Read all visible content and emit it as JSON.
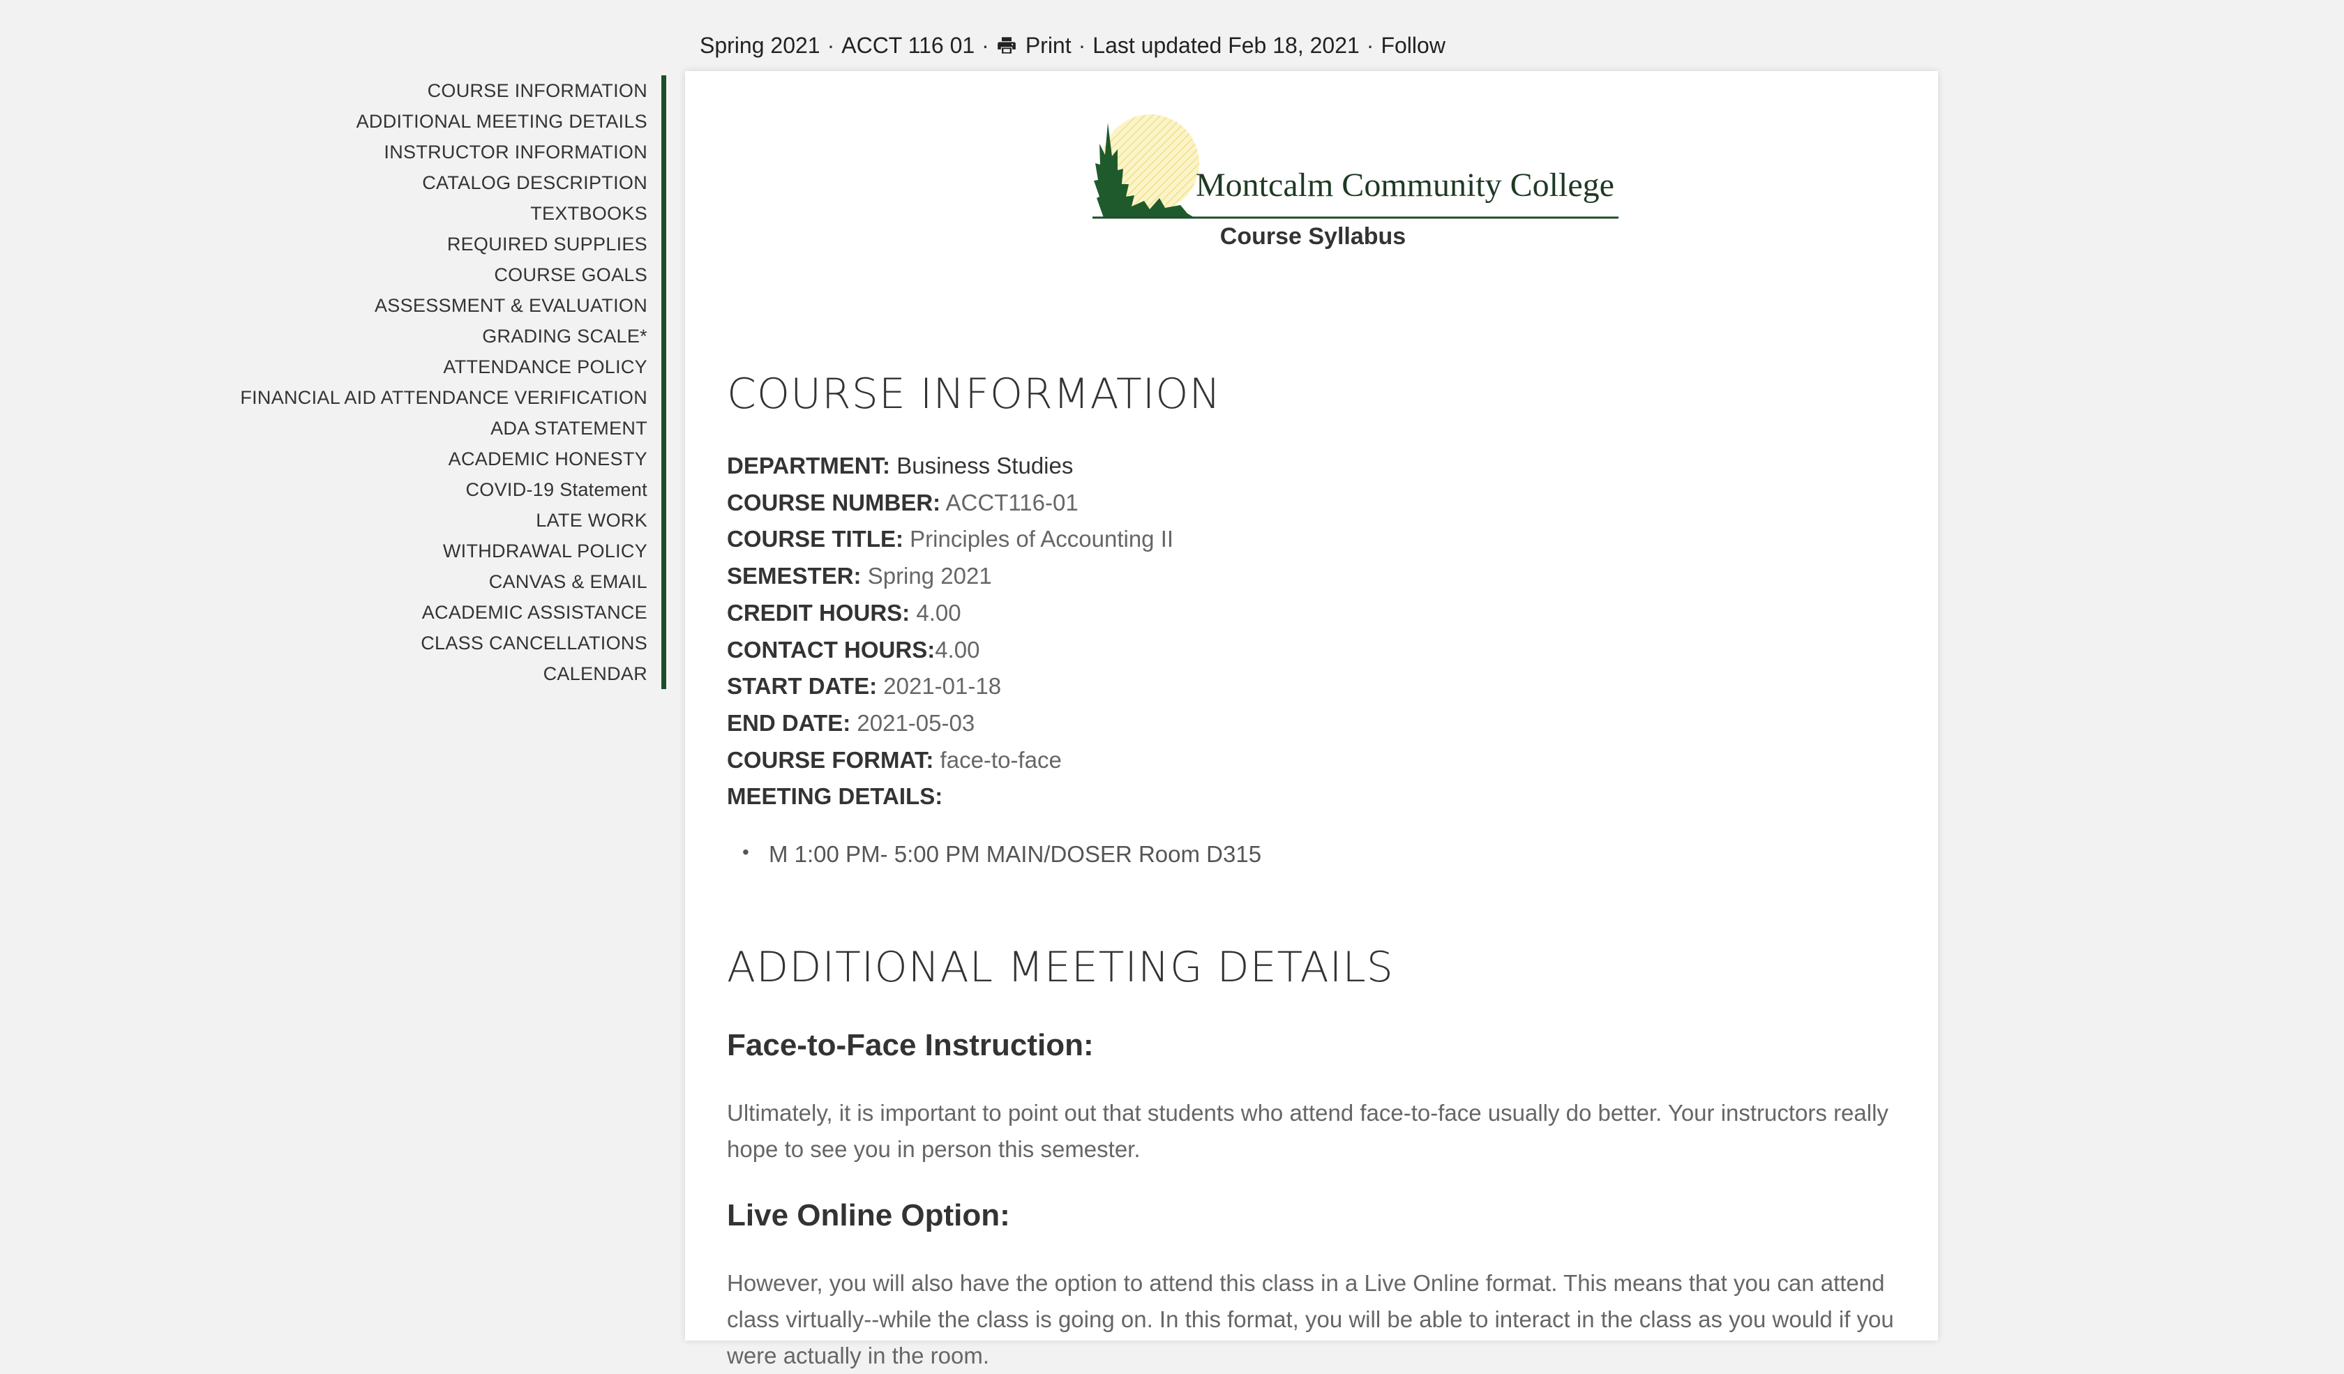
{
  "topbar": {
    "semester": "Spring 2021",
    "sep1": "·",
    "course_code": "ACCT 116 01",
    "sep2": "·",
    "print_icon": "printer-icon",
    "print_label": "Print",
    "sep3": "·",
    "last_updated": "Last updated Feb 18, 2021",
    "sep4": "·",
    "follow_label": "Follow"
  },
  "nav": {
    "accent_color": "#1e4d2b",
    "items": [
      "COURSE INFORMATION",
      "ADDITIONAL MEETING DETAILS",
      "INSTRUCTOR INFORMATION",
      "CATALOG DESCRIPTION",
      "TEXTBOOKS",
      "REQUIRED SUPPLIES",
      "COURSE GOALS",
      "ASSESSMENT & EVALUATION",
      "GRADING SCALE*",
      "ATTENDANCE POLICY",
      "FINANCIAL AID ATTENDANCE VERIFICATION",
      "ADA STATEMENT",
      "ACADEMIC HONESTY",
      "COVID-19 Statement",
      "LATE WORK",
      "WITHDRAWAL POLICY",
      "CANVAS & EMAIL",
      "ACADEMIC ASSISTANCE",
      "CLASS CANCELLATIONS",
      "CALENDAR"
    ]
  },
  "header": {
    "logo_text": "Montcalm Community College",
    "subtitle": "Course Syllabus"
  },
  "course_info": {
    "heading": "COURSE INFORMATION",
    "department_label": "DEPARTMENT:",
    "department_value": "Business Studies",
    "course_number_label": "COURSE NUMBER:",
    "course_number_value": "ACCT116-01",
    "course_title_label": "COURSE TITLE:",
    "course_title_value": "Principles of Accounting II",
    "semester_label": "SEMESTER:",
    "semester_value": "Spring 2021",
    "credit_hours_label": "CREDIT HOURS:",
    "credit_hours_value": "4.00",
    "contact_hours_label": "CONTACT HOURS:",
    "contact_hours_value": "4.00",
    "start_date_label": "START DATE:",
    "start_date_value": "2021-01-18",
    "end_date_label": "END DATE:",
    "end_date_value": "2021-05-03",
    "course_format_label": "COURSE FORMAT:",
    "course_format_value": "face-to-face",
    "meeting_details_label": "MEETING DETAILS:",
    "meeting_item": "M 1:00 PM- 5:00 PM MAIN/DOSER Room D315"
  },
  "additional": {
    "heading": "ADDITIONAL MEETING DETAILS",
    "f2f_heading": "Face-to-Face Instruction:",
    "f2f_text": "Ultimately, it is important to point out that students who attend face-to-face usually do better. Your instructors really hope to see you in person this semester.",
    "live_heading": "Live Online Option:",
    "live_text": "However, you will also have the option to attend this class in a Live Online format. This means that you can attend class virtually--while the class is going on. In this format, you will be able to interact in the class as you would if you were actually in the room."
  }
}
